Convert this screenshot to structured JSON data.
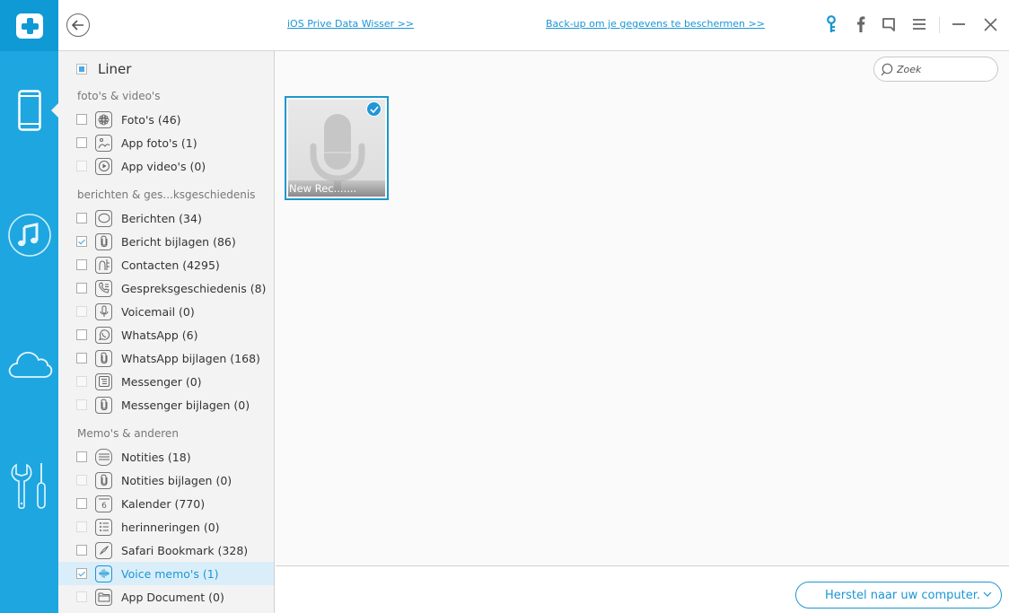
{
  "app": {
    "logo_icon": "dr-fone-plus-logo",
    "accent_color": "#1ea6e0"
  },
  "rail": {
    "items": [
      {
        "icon": "phone-icon",
        "label": "iOS device recovery",
        "active": true
      },
      {
        "icon": "music-icon",
        "label": "iTunes recovery",
        "active": false
      },
      {
        "icon": "cloud-icon",
        "label": "iCloud recovery",
        "active": false
      },
      {
        "icon": "tools-icon",
        "label": "Tools",
        "active": false
      }
    ]
  },
  "topbar": {
    "back_icon": "arrow-left-icon",
    "link_eraser": "iOS Prive Data Wisser >>",
    "link_backup": "Back-up om je gegevens te beschermen >>",
    "icons": [
      "key-icon",
      "facebook-icon",
      "feedback-icon",
      "menu-icon",
      "minimize-icon",
      "close-icon"
    ]
  },
  "panel": {
    "header_label": "Liner",
    "groups": [
      {
        "title": "foto's & video's",
        "items": [
          {
            "label": "Foto's (46)",
            "icon": "photos-flower-icon",
            "checked": false,
            "disabled": false
          },
          {
            "label": "App foto's (1)",
            "icon": "image-icon",
            "checked": false,
            "disabled": false
          },
          {
            "label": "App video's (0)",
            "icon": "play-icon",
            "checked": false,
            "disabled": true
          }
        ]
      },
      {
        "title": "berichten & ges...ksgeschiedenis",
        "items": [
          {
            "label": "Berichten (34)",
            "icon": "chat-bubble-icon",
            "checked": false,
            "disabled": false
          },
          {
            "label": "Bericht bijlagen (86)",
            "icon": "paperclip-icon",
            "checked": true,
            "disabled": false
          },
          {
            "label": "Contacten (4295)",
            "icon": "contacts-icon",
            "checked": false,
            "disabled": false
          },
          {
            "label": "Gespreksgeschiedenis (8)",
            "icon": "call-history-icon",
            "checked": false,
            "disabled": false
          },
          {
            "label": "Voicemail (0)",
            "icon": "microphone-icon",
            "checked": false,
            "disabled": true
          },
          {
            "label": "WhatsApp (6)",
            "icon": "whatsapp-icon",
            "checked": false,
            "disabled": false
          },
          {
            "label": "WhatsApp bijlagen (168)",
            "icon": "paperclip-icon",
            "checked": false,
            "disabled": false
          },
          {
            "label": "Messenger (0)",
            "icon": "messenger-icon",
            "checked": false,
            "disabled": true
          },
          {
            "label": "Messenger bijlagen (0)",
            "icon": "paperclip-icon",
            "checked": false,
            "disabled": true
          }
        ]
      },
      {
        "title": "Memo's & anderen",
        "items": [
          {
            "label": "Notities (18)",
            "icon": "notes-icon",
            "checked": false,
            "disabled": false
          },
          {
            "label": "Notities bijlagen (0)",
            "icon": "paperclip-icon",
            "checked": false,
            "disabled": true
          },
          {
            "label": "Kalender (770)",
            "icon": "calendar-icon",
            "checked": false,
            "disabled": false
          },
          {
            "label": "herinneringen (0)",
            "icon": "reminders-list-icon",
            "checked": false,
            "disabled": true
          },
          {
            "label": "Safari Bookmark (328)",
            "icon": "compass-icon",
            "checked": false,
            "disabled": false
          },
          {
            "label": "Voice memo's (1)",
            "icon": "waveform-icon",
            "checked": true,
            "disabled": false,
            "selected": true
          },
          {
            "label": "App Document (0)",
            "icon": "folder-icon",
            "checked": false,
            "disabled": true
          }
        ]
      }
    ]
  },
  "content": {
    "search_placeholder": "Zoek",
    "items": [
      {
        "title": "New Rec.......",
        "icon": "microphone-icon",
        "checked": true
      }
    ]
  },
  "footer": {
    "restore_label": "Herstel naar uw computer."
  }
}
